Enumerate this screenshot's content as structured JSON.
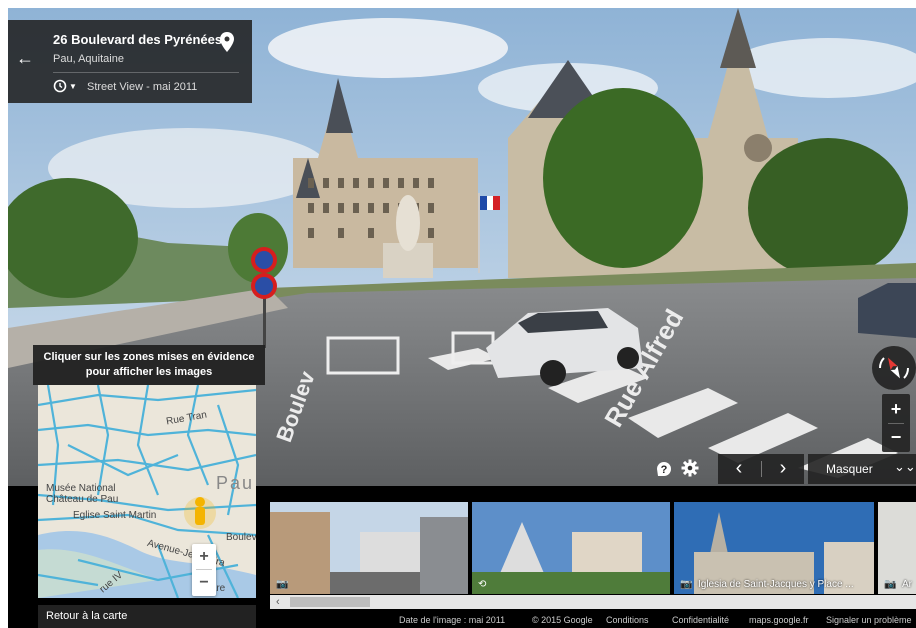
{
  "address_card": {
    "title": "26 Boulevard des Pyrénées",
    "subtitle": "Pau, Aquitaine",
    "street_view_date": "Street View - mai 2011",
    "back_icon": "back-arrow-icon",
    "pin_icon": "location-pin-icon",
    "clock_icon": "clock-history-icon"
  },
  "controls": {
    "zoom_in": "+",
    "zoom_out": "−",
    "prev": "‹",
    "next": "›",
    "hide_label": "Masquer",
    "hide_chevron": "»"
  },
  "minimap": {
    "tooltip": "Cliquer sur les zones mises en évidence pour afficher les images",
    "labels": {
      "rue_tran": "Rue Tran",
      "pau": "Pau",
      "musee": "Musée National",
      "chateau": "Château de Pau",
      "eglise": "Eglise Saint Martin",
      "boulevard": "Bouleva",
      "avenue": "Avenue-Jean-Bira",
      "gare": "Gare",
      "rue_iv": "rue IV"
    },
    "zoom_in": "+",
    "zoom_out": "−",
    "back_to_map": "Retour à la carte"
  },
  "thumbnails": [
    {
      "icon": "camera-icon",
      "label": ""
    },
    {
      "icon": "panorama-360-icon",
      "label": ""
    },
    {
      "icon": "camera-icon",
      "label": "Iglesia de Saint-Jacques y Place ..."
    },
    {
      "icon": "camera-icon",
      "label": "Ar"
    }
  ],
  "scroll": {
    "left_arrow": "‹"
  },
  "footer": {
    "image_date": "Date de l'image : mai 2011",
    "copyright": "© 2015 Google",
    "conditions": "Conditions",
    "privacy": "Confidentialité",
    "domain": "maps.google.fr",
    "report": "Signaler un problème"
  },
  "scene_text": {
    "street_name": "Rue Alfred",
    "boulevard": "Boulev"
  },
  "colors": {
    "panel_dark": "#212121",
    "map_road": "#4fb3d9",
    "pegman": "#f4b400"
  }
}
